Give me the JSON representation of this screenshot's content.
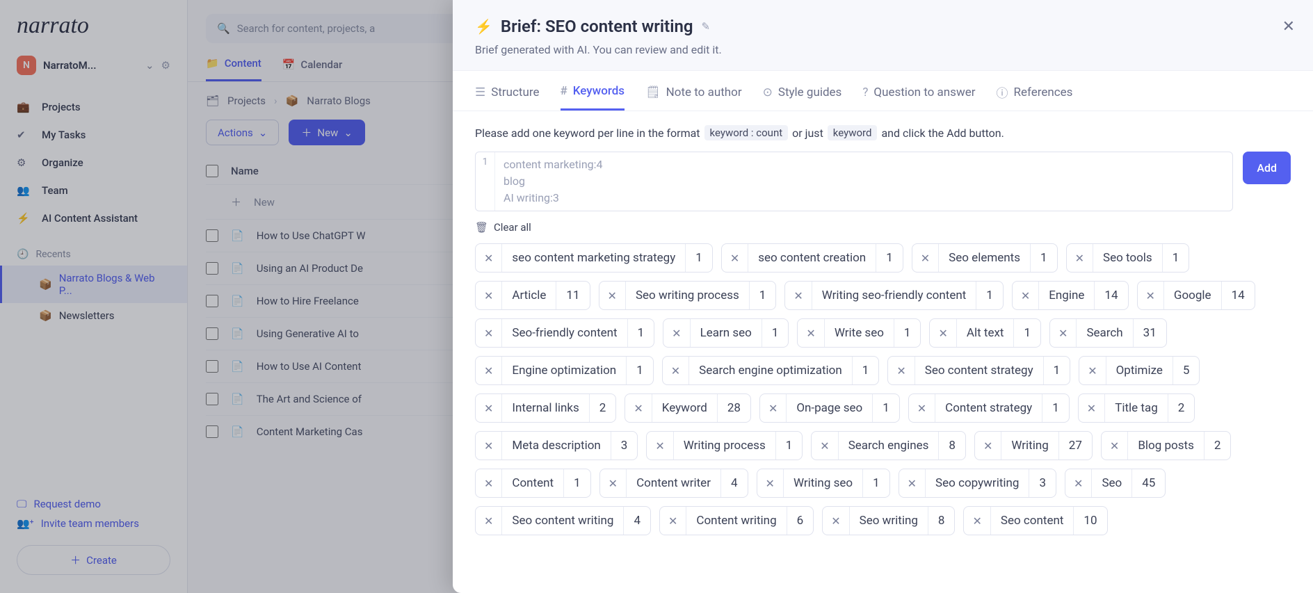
{
  "logo_text": "narrato",
  "workspace": {
    "initial": "N",
    "name": "NarratoM..."
  },
  "sidebar": [
    {
      "icon": "briefcase",
      "label": "Projects"
    },
    {
      "icon": "check",
      "label": "My Tasks"
    },
    {
      "icon": "gears",
      "label": "Organize"
    },
    {
      "icon": "team",
      "label": "Team"
    },
    {
      "icon": "bolt",
      "label": "AI Content Assistant"
    }
  ],
  "recents_header": "Recents",
  "recents": [
    {
      "label": "Narrato Blogs & Web P...",
      "active": true
    },
    {
      "label": "Newsletters",
      "active": false
    }
  ],
  "sb_links": {
    "demo": "Request demo",
    "invite": "Invite team members",
    "create": "Create"
  },
  "search_placeholder": "Search for content, projects, a",
  "main_tabs": [
    {
      "icon": "folder",
      "label": "Content",
      "active": true
    },
    {
      "icon": "calendar",
      "label": "Calendar",
      "active": false
    }
  ],
  "breadcrumbs": [
    "Projects",
    "Narrato Blogs"
  ],
  "toolbar": {
    "actions": "Actions",
    "new": "New"
  },
  "table": {
    "col_name": "Name",
    "new_row": "New",
    "rows": [
      "How to Use ChatGPT W",
      "Using an AI Product De",
      "How to Hire Freelance",
      "Using Generative AI to",
      "How to Use AI Content",
      "The Art and Science of",
      "Content Marketing Cas"
    ]
  },
  "modal": {
    "title": "Brief: SEO content writing",
    "subtitle": "Brief generated with AI. You can review and edit it.",
    "tabs": [
      {
        "icon": "struct",
        "label": "Structure"
      },
      {
        "icon": "hash",
        "label": "Keywords",
        "active": true
      },
      {
        "icon": "note",
        "label": "Note to author"
      },
      {
        "icon": "style",
        "label": "Style guides"
      },
      {
        "icon": "question",
        "label": "Question to answer"
      },
      {
        "icon": "ref",
        "label": "References"
      }
    ],
    "instruction_pre": "Please add one keyword per line in the format",
    "instruction_fmt1": "keyword : count",
    "instruction_mid": "or just",
    "instruction_fmt2": "keyword",
    "instruction_post": "and click the Add button.",
    "gutter": "1",
    "placeholder": "content marketing:4\nblog\nAI writing:3",
    "add_label": "Add",
    "clear_label": "Clear all",
    "keywords": [
      {
        "kw": "seo content marketing strategy",
        "n": "1"
      },
      {
        "kw": "seo content creation",
        "n": "1"
      },
      {
        "kw": "Seo elements",
        "n": "1"
      },
      {
        "kw": "Seo tools",
        "n": "1"
      },
      {
        "kw": "Article",
        "n": "11"
      },
      {
        "kw": "Seo writing process",
        "n": "1"
      },
      {
        "kw": "Writing seo-friendly content",
        "n": "1"
      },
      {
        "kw": "Engine",
        "n": "14"
      },
      {
        "kw": "Google",
        "n": "14"
      },
      {
        "kw": "Seo-friendly content",
        "n": "1"
      },
      {
        "kw": "Learn seo",
        "n": "1"
      },
      {
        "kw": "Write seo",
        "n": "1"
      },
      {
        "kw": "Alt text",
        "n": "1"
      },
      {
        "kw": "Search",
        "n": "31"
      },
      {
        "kw": "Engine optimization",
        "n": "1"
      },
      {
        "kw": "Search engine optimization",
        "n": "1"
      },
      {
        "kw": "Seo content strategy",
        "n": "1"
      },
      {
        "kw": "Optimize",
        "n": "5"
      },
      {
        "kw": "Internal links",
        "n": "2"
      },
      {
        "kw": "Keyword",
        "n": "28"
      },
      {
        "kw": "On-page seo",
        "n": "1"
      },
      {
        "kw": "Content strategy",
        "n": "1"
      },
      {
        "kw": "Title tag",
        "n": "2"
      },
      {
        "kw": "Meta description",
        "n": "3"
      },
      {
        "kw": "Writing process",
        "n": "1"
      },
      {
        "kw": "Search engines",
        "n": "8"
      },
      {
        "kw": "Writing",
        "n": "27"
      },
      {
        "kw": "Blog posts",
        "n": "2"
      },
      {
        "kw": "Content",
        "n": "1"
      },
      {
        "kw": "Content writer",
        "n": "4"
      },
      {
        "kw": "Writing seo",
        "n": "1"
      },
      {
        "kw": "Seo copywriting",
        "n": "3"
      },
      {
        "kw": "Seo",
        "n": "45"
      },
      {
        "kw": "Seo content writing",
        "n": "4"
      },
      {
        "kw": "Content writing",
        "n": "6"
      },
      {
        "kw": "Seo writing",
        "n": "8"
      },
      {
        "kw": "Seo content",
        "n": "10"
      }
    ]
  }
}
